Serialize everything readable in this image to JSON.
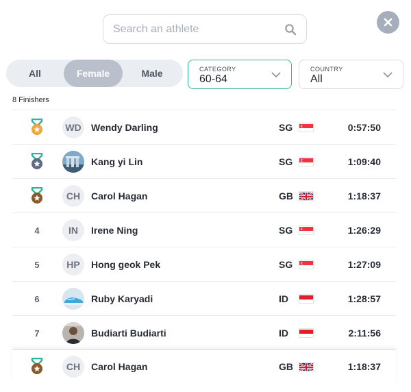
{
  "search": {
    "placeholder": "Search an athlete"
  },
  "gender_tabs": [
    {
      "label": "All",
      "active": false
    },
    {
      "label": "Female",
      "active": true
    },
    {
      "label": "Male",
      "active": false
    }
  ],
  "filters": {
    "category": {
      "label": "CATEGORY",
      "value": "60-64"
    },
    "country": {
      "label": "COUNTRY",
      "value": "All"
    }
  },
  "finishers_count": "8 Finishers",
  "colors": {
    "accent": "#2fb39a",
    "gold": "#f0a73c",
    "silver": "#5e6b82",
    "bronze": "#8b5a2b",
    "medal_ribbon": "#2fb39a"
  },
  "results": [
    {
      "rank": "1",
      "medal": "gold",
      "initials": "WD",
      "photo": "",
      "name": "Wendy Darling",
      "country": "SG",
      "flag": "sg-flag",
      "time": "0:57:50"
    },
    {
      "rank": "2",
      "medal": "silver",
      "initials": "",
      "photo": "city-photo",
      "name": "Kang yi Lin",
      "country": "SG",
      "flag": "sg-flag",
      "time": "1:09:40"
    },
    {
      "rank": "3",
      "medal": "bronze",
      "initials": "CH",
      "photo": "",
      "name": "Carol Hagan",
      "country": "GB",
      "flag": "gb-flag",
      "time": "1:18:37"
    },
    {
      "rank": "4",
      "medal": "",
      "initials": "IN",
      "photo": "",
      "name": "Irene Ning",
      "country": "SG",
      "flag": "sg-flag",
      "time": "1:26:29"
    },
    {
      "rank": "5",
      "medal": "",
      "initials": "HP",
      "photo": "",
      "name": "Hong geok Pek",
      "country": "SG",
      "flag": "sg-flag",
      "time": "1:27:09"
    },
    {
      "rank": "6",
      "medal": "",
      "initials": "",
      "photo": "shoe-photo",
      "name": "Ruby Karyadi",
      "country": "ID",
      "flag": "id-flag",
      "time": "1:28:57"
    },
    {
      "rank": "7",
      "medal": "",
      "initials": "",
      "photo": "portrait-photo",
      "name": "Budiarti Budiarti",
      "country": "ID",
      "flag": "id-flag",
      "time": "2:11:56"
    }
  ],
  "pinned": {
    "rank": "3",
    "medal": "bronze",
    "initials": "CH",
    "photo": "",
    "name": "Carol Hagan",
    "country": "GB",
    "flag": "gb-flag",
    "time": "1:18:37"
  }
}
